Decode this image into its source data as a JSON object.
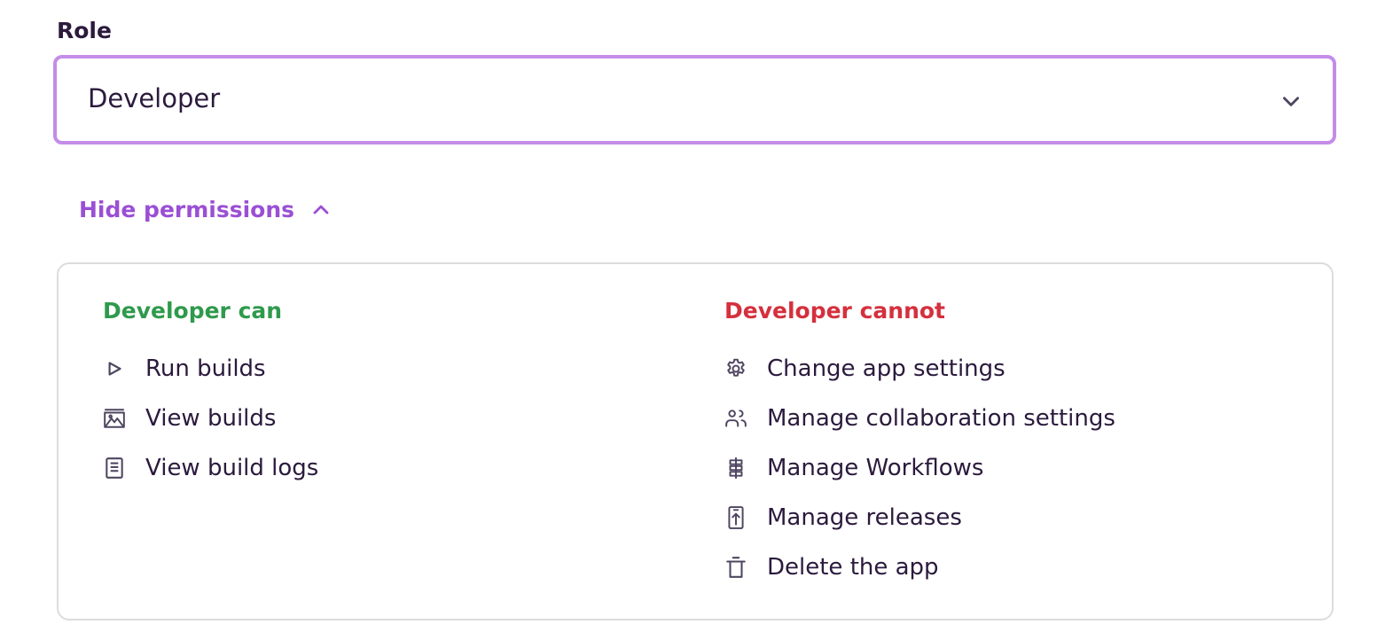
{
  "role": {
    "label": "Role",
    "selected_value": "Developer"
  },
  "toggle": {
    "label": "Hide permissions"
  },
  "permissions": {
    "can": {
      "title": "Developer can",
      "items": [
        {
          "label": "Run builds",
          "icon": "play-icon"
        },
        {
          "label": "View builds",
          "icon": "builds-icon"
        },
        {
          "label": "View build logs",
          "icon": "log-icon"
        }
      ]
    },
    "cannot": {
      "title": "Developer cannot",
      "items": [
        {
          "label": "Change app settings",
          "icon": "gear-icon"
        },
        {
          "label": "Manage collaboration settings",
          "icon": "users-icon"
        },
        {
          "label": "Manage Workflows",
          "icon": "workflow-icon"
        },
        {
          "label": "Manage releases",
          "icon": "release-icon"
        },
        {
          "label": "Delete the app",
          "icon": "trash-icon"
        }
      ]
    }
  },
  "colors": {
    "accent": "#9a4fd4",
    "select_border": "#c48ce8",
    "can": "#2f9a4c",
    "cannot": "#d5303d",
    "text": "#2b1a3d"
  }
}
